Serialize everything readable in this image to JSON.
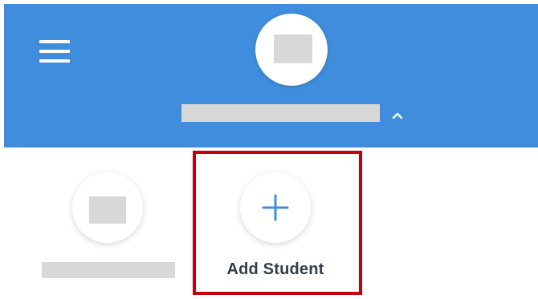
{
  "header": {
    "menu_icon": "hamburger-menu-icon",
    "dropdown_icon": "chevron-up-icon",
    "background_color": "#3f8ddc"
  },
  "students": {
    "add_student_label": "Add Student",
    "add_icon": "plus-icon",
    "accent_color": "#3f8ddc",
    "highlight_color": "#c0000e"
  }
}
